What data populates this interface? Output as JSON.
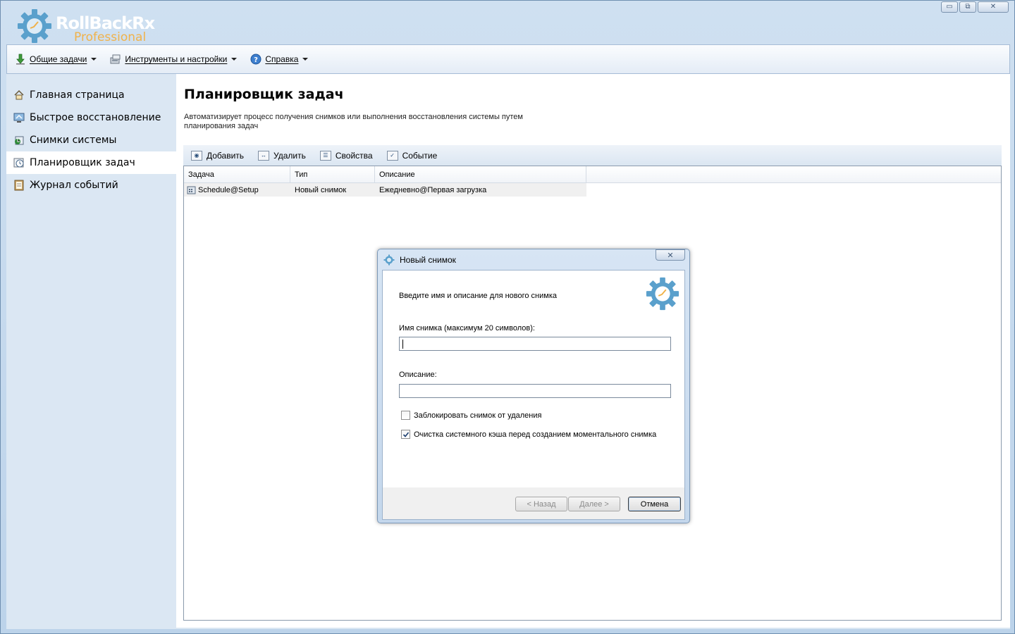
{
  "app": {
    "logo_main": "RollBackRx",
    "logo_sub": "Professional"
  },
  "window_controls": {
    "minimize": "▭",
    "restore": "⧉",
    "close": "✕"
  },
  "menu": {
    "items": [
      {
        "label": "Общие задачи",
        "icon": "download-arrow-icon"
      },
      {
        "label": "Инструменты и настройки",
        "icon": "tools-icon"
      },
      {
        "label": "Справка",
        "icon": "help-icon"
      }
    ]
  },
  "sidebar": {
    "items": [
      {
        "label": "Главная страница",
        "icon": "home-icon"
      },
      {
        "label": "Быстрое восстановление",
        "icon": "restore-icon"
      },
      {
        "label": "Снимки системы",
        "icon": "snapshot-icon"
      },
      {
        "label": "Планировщик задач",
        "icon": "clock-icon",
        "active": true
      },
      {
        "label": "Журнал событий",
        "icon": "log-icon"
      }
    ]
  },
  "page": {
    "title": "Планировщик задач",
    "description": "Автоматизирует процесс получения снимков или выполнения восстановления системы путем планирования задач"
  },
  "actions": {
    "add": "Добавить",
    "delete": "Удалить",
    "properties": "Свойства",
    "event": "Событие"
  },
  "grid": {
    "columns": [
      "Задача",
      "Тип",
      "Описание"
    ],
    "rows": [
      {
        "task": "Schedule@Setup",
        "type": "Новый снимок",
        "description": "Ежедневно@Первая загрузка"
      }
    ]
  },
  "dialog": {
    "title": "Новый снимок",
    "close": "✕",
    "intro": "Введите имя и описание для нового снимка",
    "name_label": "Имя снимка (максимум 20 символов):",
    "name_value": "",
    "desc_label": "Описание:",
    "desc_value": "",
    "lock_label": "Заблокировать снимок от удаления",
    "lock_checked": false,
    "clear_cache_label": "Очистка системного кэша перед созданием моментального снимка",
    "clear_cache_checked": true,
    "back_button": "< Назад",
    "next_button": "Далее >",
    "cancel_button": "Отмена"
  },
  "colors": {
    "brand_blue": "#5aa0cc",
    "brand_orange": "#f0b24a",
    "frame_blue": "#c9dcee"
  }
}
